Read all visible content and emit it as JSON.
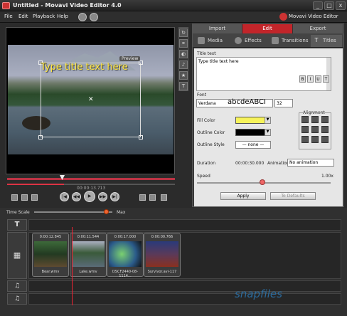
{
  "window": {
    "title": "Untitled - Movavi Video Editor 4.0",
    "min": "_",
    "max": "□",
    "close": "x"
  },
  "menu": [
    "File",
    "Edit",
    "Playback",
    "Help"
  ],
  "brand": "Movavi Video Editor",
  "preview": {
    "overlay_text": "Type title text here",
    "preview_label": "Preview",
    "timecode": "00:00:13.713"
  },
  "main_tabs": [
    "Import",
    "Edit",
    "Export"
  ],
  "sub_tabs": [
    "Media",
    "Effects",
    "Transitions",
    "Titles"
  ],
  "form": {
    "title_text_label": "Title text",
    "title_text_value": "Type title text here",
    "font_label": "Font",
    "font_value": "Verdana",
    "font_preview": "abcdeABCI",
    "size_value": "32",
    "format_buttons": [
      "B",
      "I",
      "U",
      "T"
    ],
    "alignment_label": "Alignment",
    "fill_color_label": "Fill Color",
    "fill_color": "#f7f35a",
    "outline_color_label": "Outline Color",
    "outline_color": "#000000",
    "outline_style_label": "Outline Style",
    "outline_style_value": "— none —",
    "duration_label": "Duration",
    "duration_value": "00:00:30.000",
    "animation_label": "Animation",
    "animation_value": "No animation",
    "speed_label": "Speed",
    "speed_value": "1.00x",
    "apply_label": "Apply",
    "defaults_label": "To Defaults"
  },
  "timeline": {
    "scale_label": "Time Scale",
    "max_label": "Max",
    "clips": [
      {
        "duration": "0:00:12.845",
        "name": "Bear.wmv"
      },
      {
        "duration": "0:00:11.544",
        "name": "Lake.wmv"
      },
      {
        "duration": "0:00:17.000",
        "name": "DSCF2440-08-1114..."
      },
      {
        "duration": "0:00:00.766",
        "name": "Survivor.avi-117"
      }
    ]
  },
  "watermark": "snapfiles",
  "colors": {
    "accent": "#c2252a",
    "title_text": "#ffe640"
  }
}
